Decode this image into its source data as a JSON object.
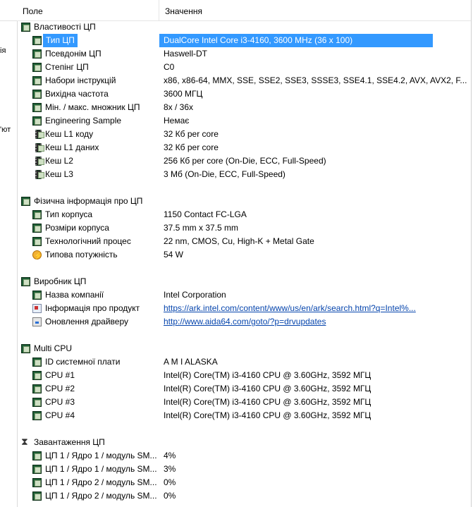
{
  "header": {
    "field_label": "Поле",
    "value_label": "Значення"
  },
  "left_strip": {
    "fragments": [
      "ія",
      "'ют"
    ]
  },
  "colors": {
    "selection": "#3399ff",
    "link": "#0645ad"
  },
  "tree": [
    {
      "kind": "group",
      "icon": "chip-icon",
      "label": "Властивості ЦП"
    },
    {
      "kind": "item",
      "icon": "chip-icon",
      "label": "Тип ЦП",
      "value": "DualCore Intel Core i3-4160, 3600 MHz (36 x 100)",
      "selected": true
    },
    {
      "kind": "item",
      "icon": "chip-icon",
      "label": "Псевдонім ЦП",
      "value": "Haswell-DT"
    },
    {
      "kind": "item",
      "icon": "chip-icon",
      "label": "Степінг ЦП",
      "value": "C0"
    },
    {
      "kind": "item",
      "icon": "chip-icon",
      "label": "Набори інструкцій",
      "value": "x86, x86-64, MMX, SSE, SSE2, SSE3, SSSE3, SSE4.1, SSE4.2, AVX, AVX2, F..."
    },
    {
      "kind": "item",
      "icon": "chip-icon",
      "label": "Вихідна частота",
      "value": "3600 МГЦ"
    },
    {
      "kind": "item",
      "icon": "chip-icon",
      "label": "Мін. / макс. множник ЦП",
      "value": "8x / 36x"
    },
    {
      "kind": "item",
      "icon": "chip-icon",
      "label": "Engineering Sample",
      "value": "Немає"
    },
    {
      "kind": "item",
      "icon": "memory-chip-icon",
      "label": "Кеш L1 коду",
      "value": "32 Кб per core"
    },
    {
      "kind": "item",
      "icon": "memory-chip-icon",
      "label": "Кеш L1 даних",
      "value": "32 Кб per core"
    },
    {
      "kind": "item",
      "icon": "memory-chip-icon",
      "label": "Кеш L2",
      "value": "256 Кб per core  (On-Die, ECC, Full-Speed)"
    },
    {
      "kind": "item",
      "icon": "memory-chip-icon",
      "label": "Кеш L3",
      "value": "3 Мб  (On-Die, ECC, Full-Speed)"
    },
    {
      "kind": "gap"
    },
    {
      "kind": "group",
      "icon": "chip-icon",
      "label": "Фізична інформація про ЦП"
    },
    {
      "kind": "item",
      "icon": "chip-icon",
      "label": "Тип корпуса",
      "value": "1150 Contact FC-LGA"
    },
    {
      "kind": "item",
      "icon": "chip-icon",
      "label": "Розміри корпуса",
      "value": "37.5 mm x 37.5 mm"
    },
    {
      "kind": "item",
      "icon": "chip-icon",
      "label": "Технологічний процес",
      "value": "22 nm, CMOS, Cu, High-K + Metal Gate"
    },
    {
      "kind": "item",
      "icon": "power-icon",
      "label": "Типова потужність",
      "value": "54 W"
    },
    {
      "kind": "gap"
    },
    {
      "kind": "group",
      "icon": "chip-icon",
      "label": "Виробник ЦП"
    },
    {
      "kind": "item",
      "icon": "chip-icon",
      "label": "Назва компанії",
      "value": "Intel Corporation"
    },
    {
      "kind": "item",
      "icon": "product-info-icon",
      "label": "Інформація про продукт",
      "value": "https://ark.intel.com/content/www/us/en/ark/search.html?q=Intel%...",
      "link": true
    },
    {
      "kind": "item",
      "icon": "driver-update-icon",
      "label": "Оновлення драйверу",
      "value": "http://www.aida64.com/goto/?p=drvupdates",
      "link": true
    },
    {
      "kind": "gap"
    },
    {
      "kind": "group",
      "icon": "chip-icon",
      "label": "Multi CPU"
    },
    {
      "kind": "item",
      "icon": "chip-icon",
      "label": "ID системної плати",
      "value": "A M I ALASKA"
    },
    {
      "kind": "item",
      "icon": "chip-icon",
      "label": "CPU #1",
      "value": "Intel(R) Core(TM) i3-4160 CPU @ 3.60GHz, 3592 МГЦ"
    },
    {
      "kind": "item",
      "icon": "chip-icon",
      "label": "CPU #2",
      "value": "Intel(R) Core(TM) i3-4160 CPU @ 3.60GHz, 3592 МГЦ"
    },
    {
      "kind": "item",
      "icon": "chip-icon",
      "label": "CPU #3",
      "value": "Intel(R) Core(TM) i3-4160 CPU @ 3.60GHz, 3592 МГЦ"
    },
    {
      "kind": "item",
      "icon": "chip-icon",
      "label": "CPU #4",
      "value": "Intel(R) Core(TM) i3-4160 CPU @ 3.60GHz, 3592 МГЦ"
    },
    {
      "kind": "gap"
    },
    {
      "kind": "group",
      "icon": "hourglass-icon",
      "label": "Завантаження ЦП"
    },
    {
      "kind": "item",
      "icon": "chip-icon",
      "label": "ЦП 1 / Ядро 1 / модуль SM...",
      "value": "4%"
    },
    {
      "kind": "item",
      "icon": "chip-icon",
      "label": "ЦП 1 / Ядро 1 / модуль SM...",
      "value": "3%"
    },
    {
      "kind": "item",
      "icon": "chip-icon",
      "label": "ЦП 1 / Ядро 2 / модуль SM...",
      "value": "0%"
    },
    {
      "kind": "item",
      "icon": "chip-icon",
      "label": "ЦП 1 / Ядро 2 / модуль SM...",
      "value": "0%"
    }
  ]
}
